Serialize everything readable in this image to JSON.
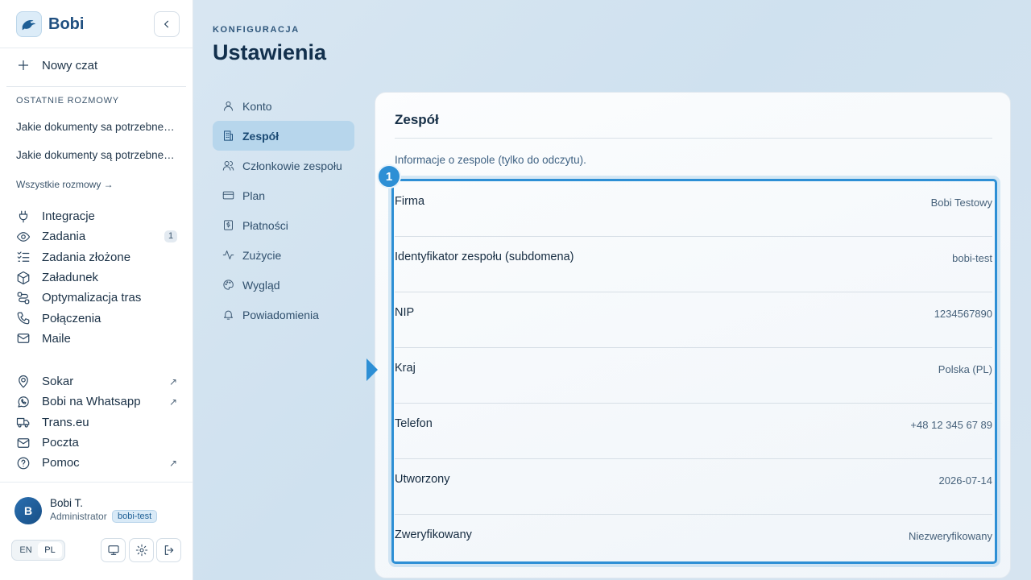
{
  "brand": {
    "name": "Bobi"
  },
  "sidebar": {
    "new_chat": "Nowy czat",
    "recent_label": "OSTATNIE ROZMOWY",
    "recent": [
      "Jakie dokumenty sa potrzebne do transportu",
      "Jakie dokumenty są potrzebne do transportu"
    ],
    "all_chats": "Wszystkie rozmowy →",
    "nav": [
      {
        "label": "Integracje",
        "icon": "plug-icon"
      },
      {
        "label": "Zadania",
        "icon": "eye-icon",
        "badge": "1"
      },
      {
        "label": "Zadania złożone",
        "icon": "checklist-icon"
      },
      {
        "label": "Załadunek",
        "icon": "box-icon"
      },
      {
        "label": "Optymalizacja tras",
        "icon": "route-icon"
      },
      {
        "label": "Połączenia",
        "icon": "phone-icon"
      },
      {
        "label": "Maile",
        "icon": "mail-icon"
      }
    ],
    "external": [
      {
        "label": "Sokar",
        "icon": "location-icon",
        "arrow": "↗"
      },
      {
        "label": "Bobi na Whatsapp",
        "icon": "whatsapp-icon",
        "arrow": "↗"
      },
      {
        "label": "Trans.eu",
        "icon": "truck-icon"
      },
      {
        "label": "Poczta",
        "icon": "mail-icon"
      },
      {
        "label": "Pomoc",
        "icon": "help-icon",
        "arrow": "↗"
      }
    ],
    "user": {
      "initial": "B",
      "name": "Bobi T.",
      "role": "Administrator",
      "team": "bobi-test"
    },
    "languages": [
      "EN",
      "PL"
    ],
    "active_language": "PL"
  },
  "header": {
    "eyebrow": "KONFIGURACJA",
    "title": "Ustawienia"
  },
  "settings_nav": [
    {
      "label": "Konto",
      "icon": "user-icon"
    },
    {
      "label": "Zespół",
      "icon": "building-icon",
      "active": true
    },
    {
      "label": "Członkowie zespołu",
      "icon": "users-icon"
    },
    {
      "label": "Plan",
      "icon": "card-icon"
    },
    {
      "label": "Płatności",
      "icon": "receipt-icon"
    },
    {
      "label": "Zużycie",
      "icon": "activity-icon"
    },
    {
      "label": "Wygląd",
      "icon": "palette-icon"
    },
    {
      "label": "Powiadomienia",
      "icon": "bell-icon"
    }
  ],
  "panel": {
    "title": "Zespół",
    "description": "Informacje o zespole (tylko do odczytu).",
    "marker": "1",
    "rows": [
      {
        "label": "Firma",
        "value": "Bobi Testowy"
      },
      {
        "label": "Identyfikator zespołu (subdomena)",
        "value": "bobi-test"
      },
      {
        "label": "NIP",
        "value": "1234567890"
      },
      {
        "label": "Kraj",
        "value": "Polska (PL)"
      },
      {
        "label": "Telefon",
        "value": "+48 12 345 67 89"
      },
      {
        "label": "Utworzony",
        "value": "2026-07-14"
      },
      {
        "label": "Zweryfikowany",
        "value": "Niezweryfikowany"
      }
    ]
  },
  "colors": {
    "accent": "#2d8fd5",
    "active_nav": "#b7d6ec",
    "brand": "#1f4f80"
  }
}
